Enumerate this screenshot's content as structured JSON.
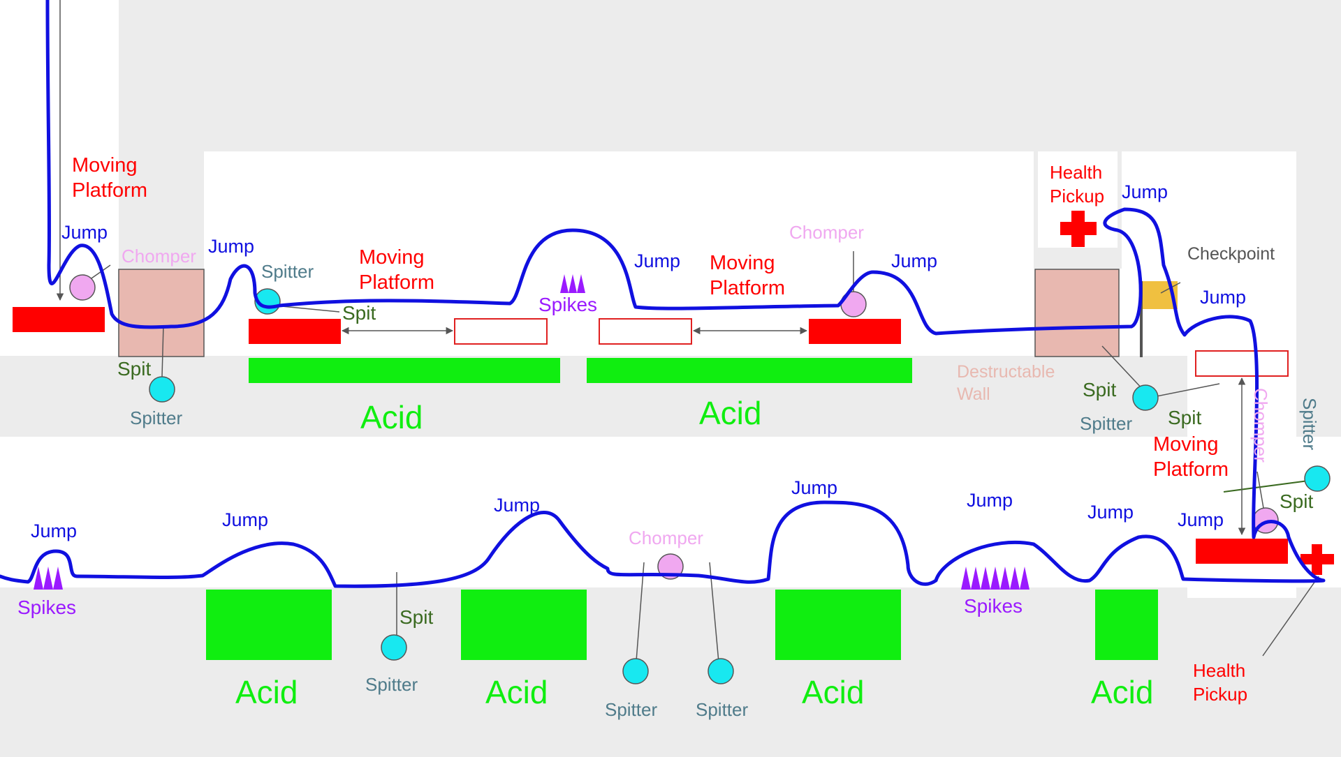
{
  "colors": {
    "background": "#ececec",
    "corridor": "#ffffff",
    "path": "#1010e0",
    "platform": "#ff0000",
    "acid": "#10ee10",
    "spikes": "#9a1aff",
    "chomper": "#f0a8f0",
    "spitter": "#18e8f0",
    "destructable_wall": "#e8b8b0",
    "checkpoint": "#f0c040",
    "spit_line": "#3a6a20"
  },
  "labels": {
    "jump": "Jump",
    "chomper": "Chomper",
    "spitter": "Spitter",
    "spit": "Spit",
    "spikes": "Spikes",
    "acid": "Acid",
    "moving_platform_1": "Moving",
    "moving_platform_2": "Platform",
    "health_pickup_1": "Health",
    "health_pickup_2": "Pickup",
    "destructable_wall_1": "Destructable",
    "destructable_wall_2": "Wall",
    "checkpoint": "Checkpoint"
  }
}
